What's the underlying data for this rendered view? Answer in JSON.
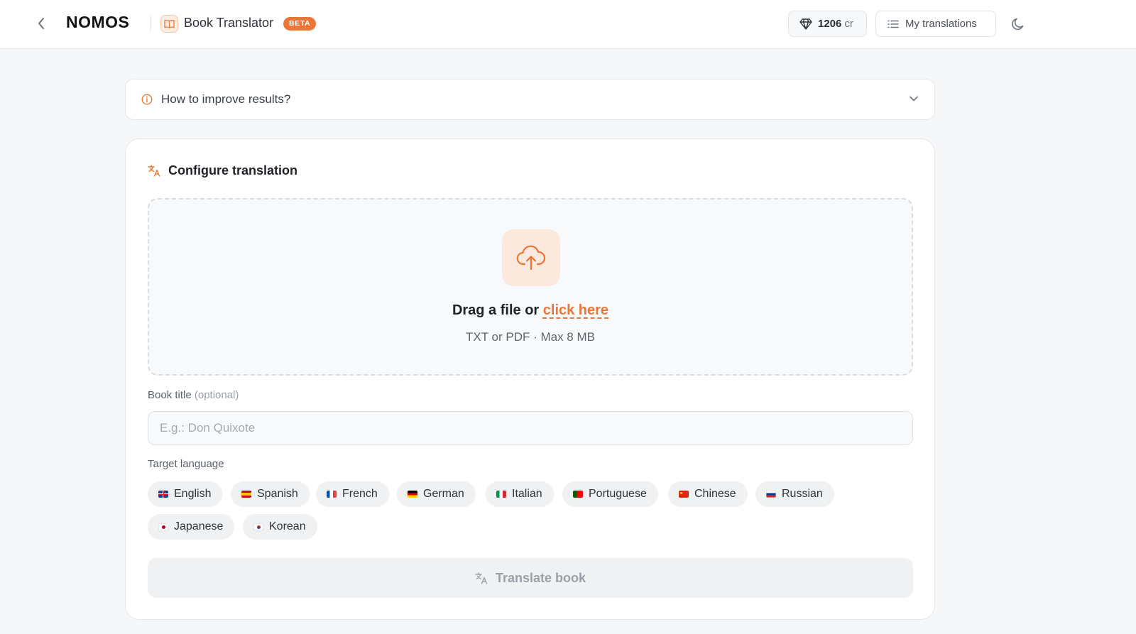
{
  "header": {
    "logo": "NOMOS",
    "app_title": "Book Translator",
    "badge": "BETA",
    "credits_value": "1206",
    "credits_unit": "cr",
    "my_translations": "My translations",
    "icons": [
      "chevron-left-icon",
      "book-open-icon",
      "gem-icon",
      "list-icon",
      "moon-icon"
    ]
  },
  "tips": {
    "label": "How to improve results?"
  },
  "config": {
    "title": "Configure translation",
    "dropzone": {
      "text": "Drag a file or",
      "link": "click here",
      "hint": "TXT or PDF · Max 8 MB"
    },
    "book_title": {
      "label": "Book title",
      "optional": "(optional)",
      "placeholder": "E.g.: Don Quixote",
      "value": ""
    },
    "target_language": {
      "label": "Target language",
      "options": [
        {
          "name": "English",
          "flag": "gb"
        },
        {
          "name": "Spanish",
          "flag": "es"
        },
        {
          "name": "French",
          "flag": "fr"
        },
        {
          "name": "German",
          "flag": "de"
        },
        {
          "name": "Italian",
          "flag": "it"
        },
        {
          "name": "Portuguese",
          "flag": "pt"
        },
        {
          "name": "Chinese",
          "flag": "cn"
        },
        {
          "name": "Russian",
          "flag": "ru"
        },
        {
          "name": "Japanese",
          "flag": "jp"
        },
        {
          "name": "Korean",
          "flag": "kr"
        }
      ]
    },
    "submit": "Translate book"
  },
  "colors": {
    "accent": "#ec7637",
    "accent_soft": "#fbe9de",
    "page_bg": "#f6f7f9"
  }
}
